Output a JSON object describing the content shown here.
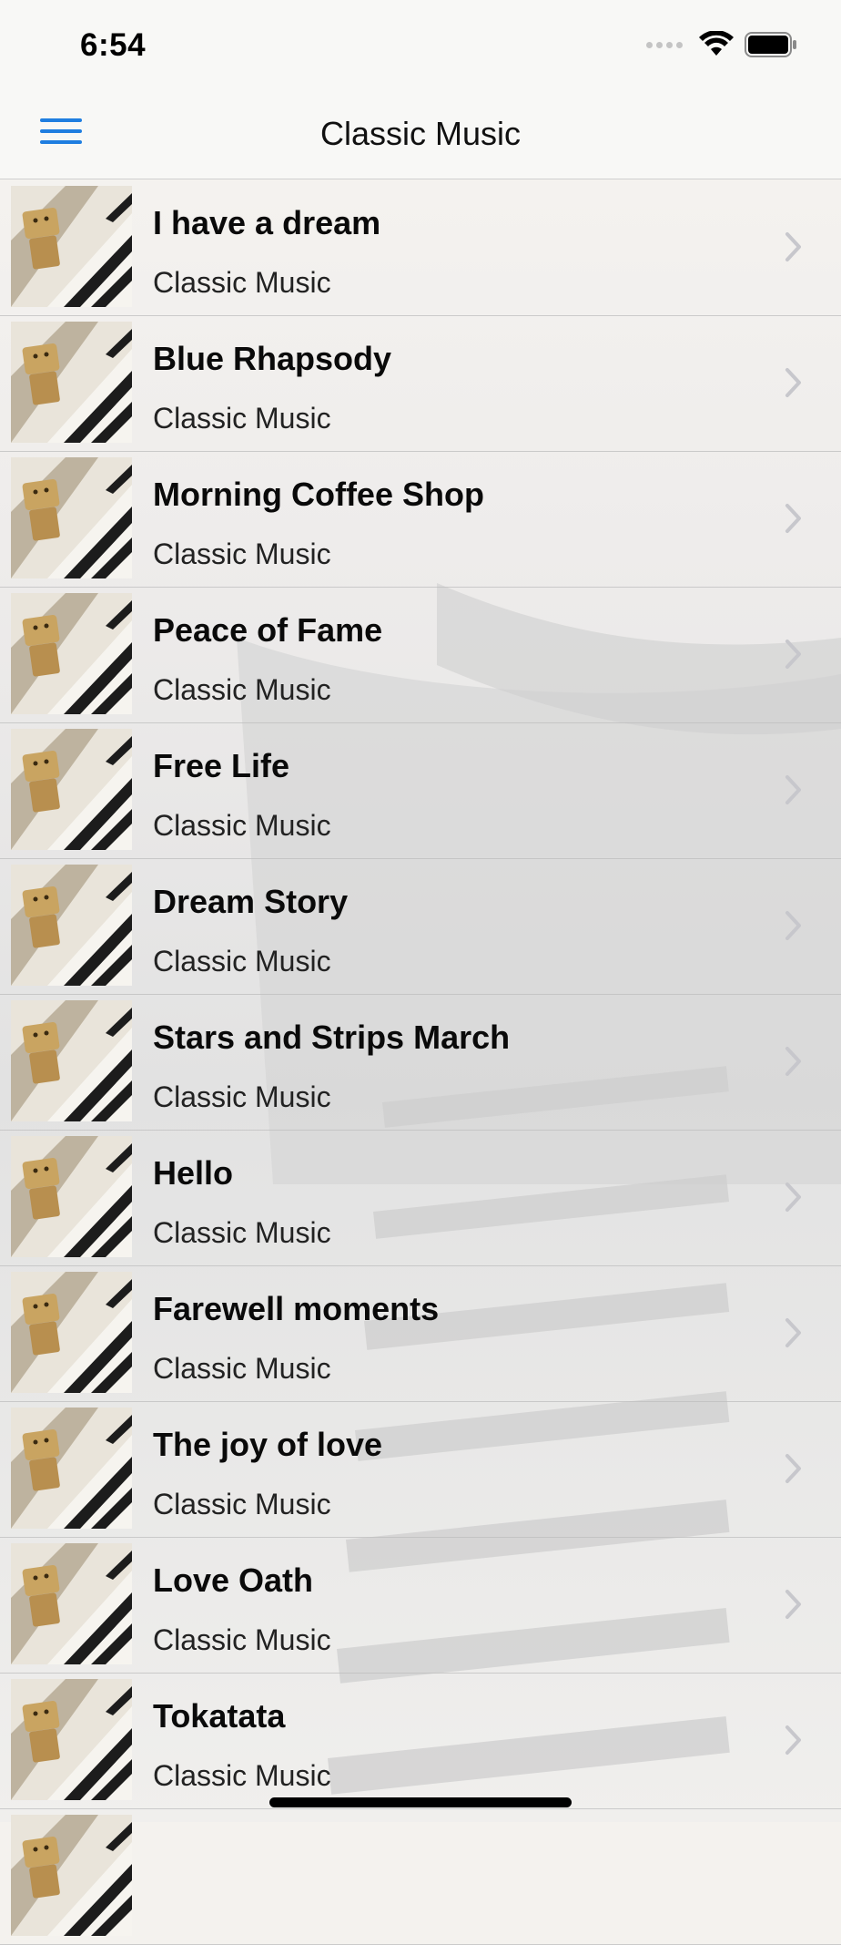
{
  "status_bar": {
    "time": "6:54"
  },
  "nav": {
    "title": "Classic Music",
    "menu_icon": "hamburger-menu-icon"
  },
  "songs": [
    {
      "title": "I have a dream",
      "subtitle": "Classic Music"
    },
    {
      "title": "Blue Rhapsody",
      "subtitle": "Classic Music"
    },
    {
      "title": "Morning Coffee Shop",
      "subtitle": "Classic Music"
    },
    {
      "title": "Peace of Fame",
      "subtitle": "Classic Music"
    },
    {
      "title": "Free Life",
      "subtitle": "Classic Music"
    },
    {
      "title": "Dream Story",
      "subtitle": "Classic Music"
    },
    {
      "title": "Stars and Strips March",
      "subtitle": "Classic Music"
    },
    {
      "title": "Hello",
      "subtitle": "Classic Music"
    },
    {
      "title": "Farewell moments",
      "subtitle": "Classic Music"
    },
    {
      "title": "The joy of love",
      "subtitle": "Classic Music"
    },
    {
      "title": "Love Oath",
      "subtitle": "Classic Music"
    },
    {
      "title": "Tokatata",
      "subtitle": "Classic Music"
    },
    {
      "title": "",
      "subtitle": ""
    }
  ],
  "colors": {
    "accent": "#1f7ee0",
    "chevron": "#c7c7cc"
  }
}
